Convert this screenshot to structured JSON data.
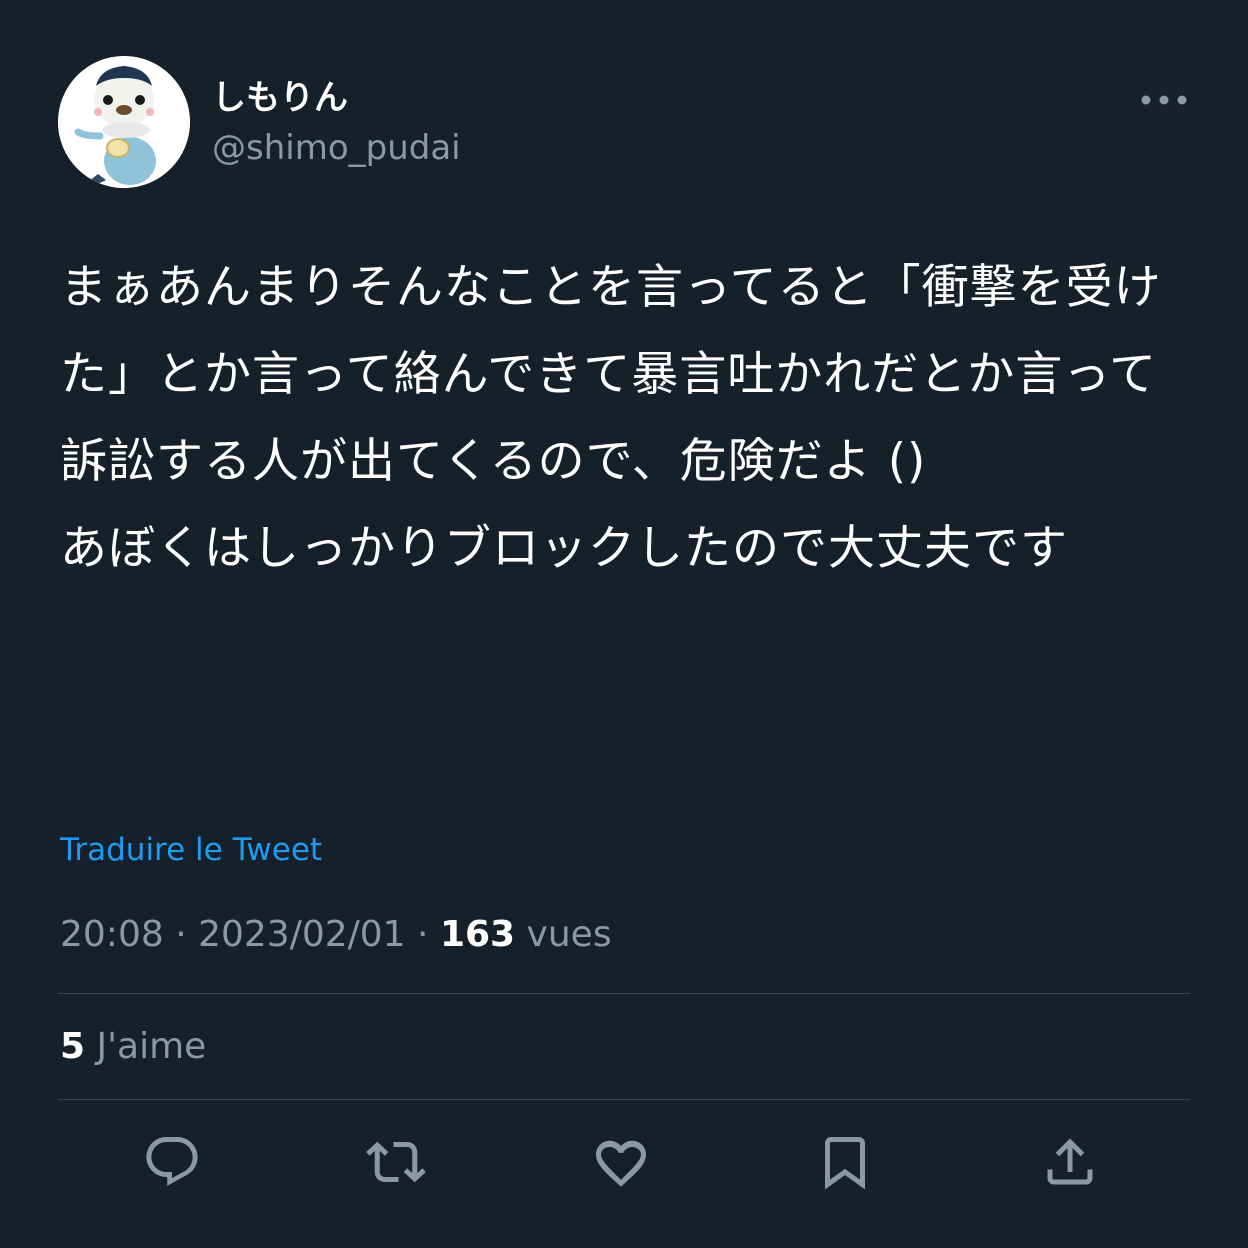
{
  "author": {
    "display_name": "しもりん",
    "handle": "@shimo_pudai",
    "avatar_icon": "otter-pokemon-avatar"
  },
  "tweet": {
    "text": "まぁあんまりそんなことを言ってると「衝撃を受けた」とか言って絡んできて暴言吐かれだとか言って訴訟する人が出てくるので、危険だよ ()\nあぼくはしっかりブロックしたので大丈夫です",
    "translate_label": "Traduire le Tweet"
  },
  "meta": {
    "time": "20:08",
    "date": "2023/02/01",
    "views_count": "163",
    "views_label": "vues"
  },
  "stats": {
    "likes_count": "5",
    "likes_label": "J'aime"
  },
  "actions": [
    {
      "name": "reply",
      "icon": "comment-icon"
    },
    {
      "name": "retweet",
      "icon": "retweet-icon"
    },
    {
      "name": "like",
      "icon": "heart-icon"
    },
    {
      "name": "bookmark",
      "icon": "bookmark-icon"
    },
    {
      "name": "share",
      "icon": "share-icon"
    }
  ],
  "colors": {
    "background": "#15202b",
    "text": "#ffffff",
    "secondary": "#8b98a5",
    "link": "#1d9bf0",
    "divider": "#38444d"
  }
}
